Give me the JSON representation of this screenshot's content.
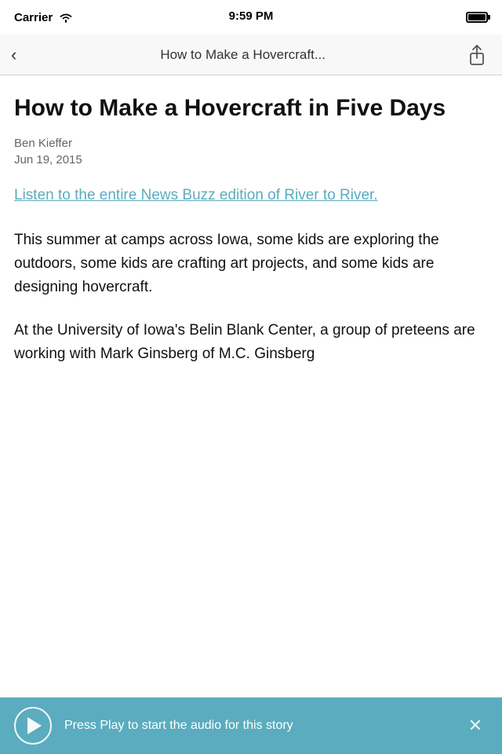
{
  "statusBar": {
    "carrier": "Carrier",
    "time": "9:59 PM"
  },
  "navBar": {
    "backLabel": "‹",
    "title": "How to Make a Hovercraft...",
    "shareIcon": "share-icon"
  },
  "article": {
    "title": "How to Make a Hovercraft in Five Days",
    "author": "Ben Kieffer",
    "date": "Jun 19, 2015",
    "linkText": "Listen to the entire News Buzz edition of River to River.",
    "body1": "This summer at camps across Iowa, some kids are exploring the outdoors, some kids are crafting art projects, and some kids are designing hovercraft.",
    "body2": "At the University of Iowa's Belin Blank Center, a group of preteens are working with Mark Ginsberg of M.C. Ginsberg"
  },
  "audioBar": {
    "playIcon": "play-icon",
    "message": "Press Play to start the audio for this story",
    "closeIcon": "close-icon"
  }
}
